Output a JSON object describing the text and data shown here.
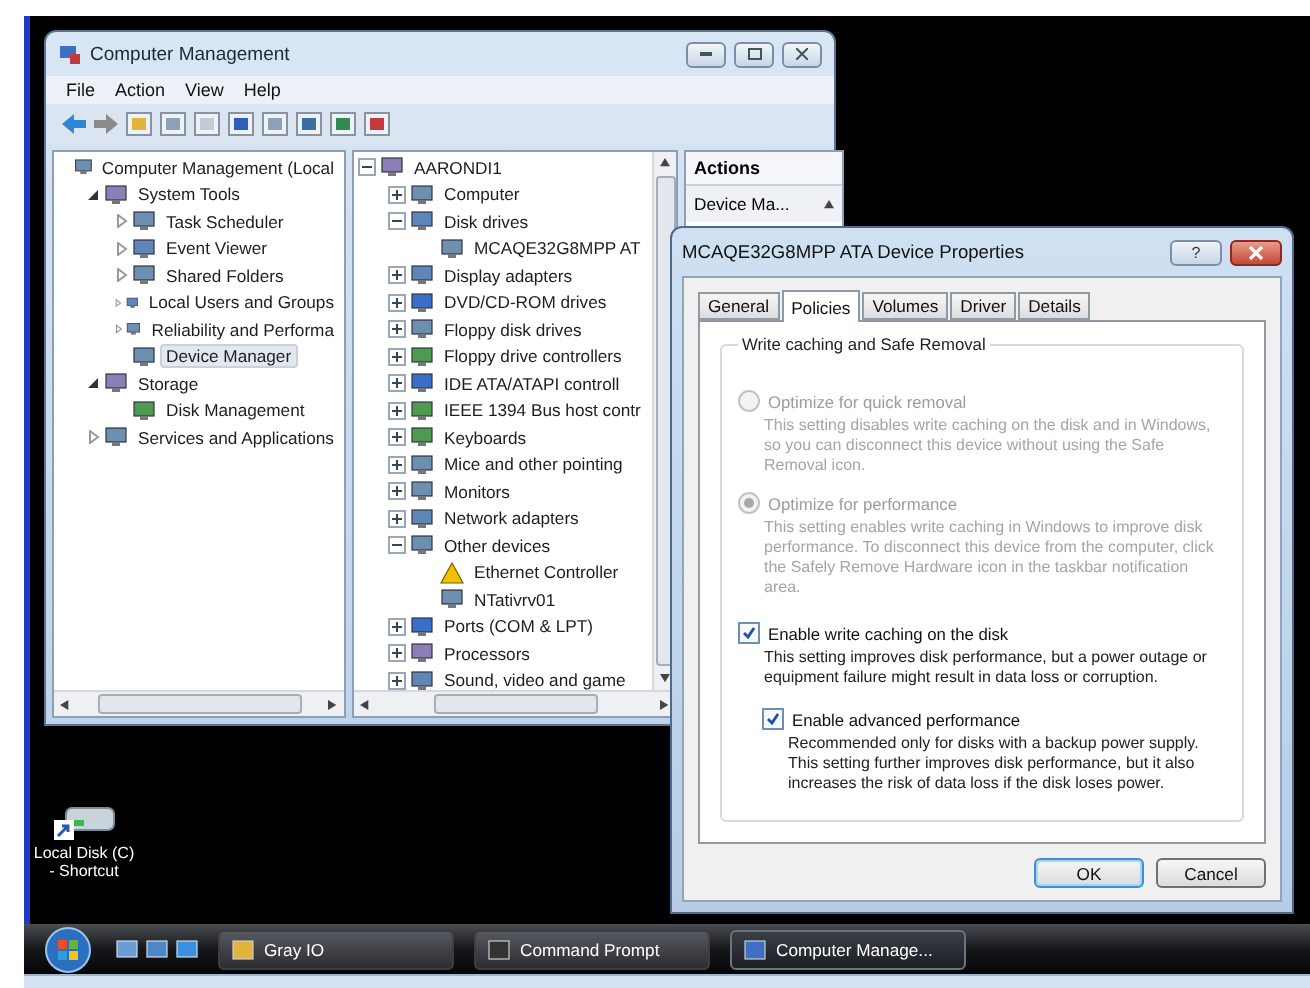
{
  "main_window": {
    "title": "Computer Management",
    "menu": [
      "File",
      "Action",
      "View",
      "Help"
    ],
    "nav_tree": [
      {
        "label": "Computer Management (Local",
        "selected": false,
        "children": [
          {
            "label": "System Tools",
            "selected": false,
            "expanded": true,
            "children": [
              {
                "label": "Task Scheduler",
                "selected": false,
                "expanded": false
              },
              {
                "label": "Event Viewer",
                "selected": false,
                "expanded": false
              },
              {
                "label": "Shared Folders",
                "selected": false,
                "expanded": false
              },
              {
                "label": "Local Users and Groups",
                "selected": false,
                "expanded": false
              },
              {
                "label": "Reliability and Performa",
                "selected": false,
                "expanded": false
              },
              {
                "label": "Device Manager",
                "selected": true
              }
            ]
          },
          {
            "label": "Storage",
            "selected": false,
            "expanded": true,
            "children": [
              {
                "label": "Disk Management",
                "selected": false
              }
            ]
          },
          {
            "label": "Services and Applications",
            "selected": false,
            "expanded": false
          }
        ]
      }
    ],
    "device_tree": [
      {
        "label": "AARONDI1",
        "expanded": true,
        "children": [
          {
            "label": "Computer",
            "expanded": false
          },
          {
            "label": "Disk drives",
            "expanded": true,
            "children": [
              {
                "label": "MCAQE32G8MPP AT"
              }
            ]
          },
          {
            "label": "Display adapters",
            "expanded": false
          },
          {
            "label": "DVD/CD-ROM drives",
            "expanded": false
          },
          {
            "label": "Floppy disk drives",
            "expanded": false
          },
          {
            "label": "Floppy drive controllers",
            "expanded": false
          },
          {
            "label": "IDE ATA/ATAPI controll",
            "expanded": false
          },
          {
            "label": "IEEE 1394 Bus host contr",
            "expanded": false
          },
          {
            "label": "Keyboards",
            "expanded": false
          },
          {
            "label": "Mice and other pointing",
            "expanded": false
          },
          {
            "label": "Monitors",
            "expanded": false
          },
          {
            "label": "Network adapters",
            "expanded": false
          },
          {
            "label": "Other devices",
            "expanded": true,
            "children": [
              {
                "label": "Ethernet Controller",
                "warning": true
              },
              {
                "label": "NTativrv01",
                "warning": false
              }
            ]
          },
          {
            "label": "Ports (COM & LPT)",
            "expanded": false
          },
          {
            "label": "Processors",
            "expanded": false
          },
          {
            "label": "Sound, video and game",
            "expanded": false
          }
        ]
      }
    ],
    "actions": {
      "title": "Actions",
      "items": [
        "Device Ma..."
      ]
    }
  },
  "dialog": {
    "title": "MCAQE32G8MPP ATA Device Properties",
    "help_glyph": "?",
    "tabs": [
      {
        "label": "General",
        "selected": false
      },
      {
        "label": "Policies",
        "selected": true
      },
      {
        "label": "Volumes",
        "selected": false
      },
      {
        "label": "Driver",
        "selected": false
      },
      {
        "label": "Details",
        "selected": false
      }
    ],
    "group_title": "Write caching and Safe Removal",
    "radios": [
      {
        "label": "Optimize for quick removal",
        "selected": false,
        "disabled": true,
        "description": "This setting disables write caching on the disk and in Windows, so you can disconnect this device without using the Safe Removal icon."
      },
      {
        "label": "Optimize for performance",
        "selected": true,
        "disabled": true,
        "description": "This setting enables write caching in Windows to improve disk performance. To disconnect this device from the computer, click the Safely Remove Hardware icon in the taskbar notification area."
      }
    ],
    "checkboxes": [
      {
        "label": "Enable write caching on the disk",
        "checked": true,
        "description": "This setting improves disk performance, but a power outage or equipment failure might result in data loss or corruption.",
        "children": [
          {
            "label": "Enable advanced performance",
            "checked": true,
            "description": "Recommended only for disks with a backup power supply. This setting further improves disk performance, but it also increases the risk of data loss if the disk loses power."
          }
        ]
      }
    ],
    "buttons": [
      {
        "label": "OK",
        "default": true
      },
      {
        "label": "Cancel",
        "default": false
      }
    ]
  },
  "desktop_icons": [
    {
      "lines": [
        "Local Disk (C)",
        "- Shortcut"
      ]
    }
  ],
  "taskbar": {
    "tasks": [
      {
        "label": "Gray IO",
        "selected": false
      },
      {
        "label": "Command Prompt",
        "selected": false
      },
      {
        "label": "Computer Manage...",
        "selected": true
      }
    ]
  }
}
